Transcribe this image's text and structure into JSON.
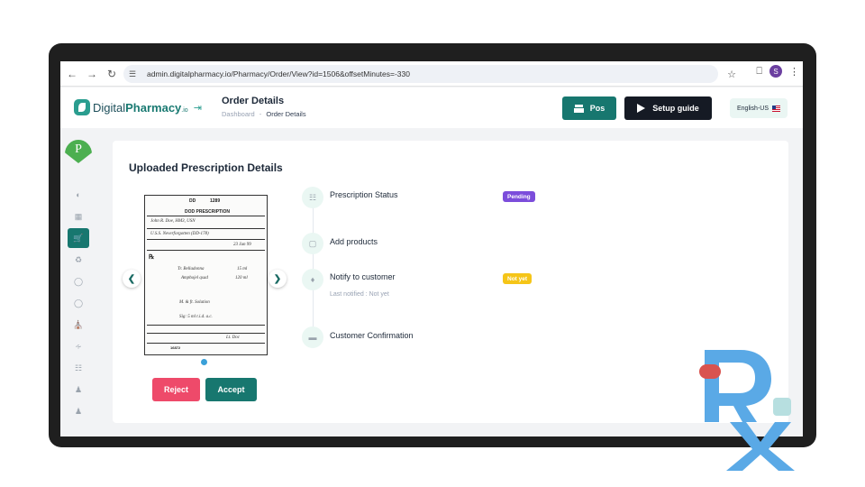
{
  "browser": {
    "url": "admin.digitalpharmacy.io/Pharmacy/Order/View?id=1506&offsetMinutes=-330",
    "profile_initial": "S"
  },
  "header": {
    "logo": {
      "prefix": "Digital",
      "brand": "Pharmacy",
      "suffix": ".io"
    },
    "title": "Order Details",
    "breadcrumb": {
      "root": "Dashboard",
      "sep": "-",
      "current": "Order Details"
    },
    "pos_label": "Pos",
    "setup_label": "Setup guide",
    "language": "English-US"
  },
  "sidebar": {
    "logo_letter": "P",
    "items": [
      {
        "icon": "dashboard-icon"
      },
      {
        "icon": "grid-icon"
      },
      {
        "icon": "cart-icon",
        "active": true
      },
      {
        "icon": "delivery-icon"
      },
      {
        "icon": "pill-icon"
      },
      {
        "icon": "capsule-icon"
      },
      {
        "icon": "store-icon"
      },
      {
        "icon": "rss-icon"
      },
      {
        "icon": "clipboard-icon"
      },
      {
        "icon": "people-icon"
      },
      {
        "icon": "people-settings-icon"
      }
    ]
  },
  "main": {
    "card_title": "Uploaded Prescription Details",
    "prescription": {
      "form_number": "DD",
      "form_code": "1289",
      "form_title": "DOD PRESCRIPTION",
      "patient": "John R. Doe, HM3, USN",
      "facility": "U.S.S. Neverforgotten (DD-178)",
      "date": "23 Jun 99",
      "rx1": "Tr. Belladonna",
      "rx2": "Amphojel qsad",
      "rx3": "15 ml",
      "rx4": "120 ml",
      "sig1": "M. & ft. Solution",
      "sig2": "Sig: 5 ml t.i.d. a.c.",
      "signature": "Lt. Doc",
      "number": "16872"
    },
    "reject_label": "Reject",
    "accept_label": "Accept",
    "timeline": [
      {
        "label": "Prescription Status",
        "badge": "Pending",
        "icon": "clipboard-icon"
      },
      {
        "label": "Add products",
        "icon": "box-icon"
      },
      {
        "label": "Notify to customer",
        "badge": "Not yet",
        "sub": "Last notified : Not yet",
        "icon": "bell-icon"
      },
      {
        "label": "Customer Confirmation",
        "icon": "confirm-icon"
      }
    ]
  },
  "colors": {
    "brand": "#17776f",
    "pending": "#7c4ddb",
    "not_yet": "#f5c518",
    "reject": "#ee4a6a",
    "rx_watermark": "#5aa9e6"
  }
}
